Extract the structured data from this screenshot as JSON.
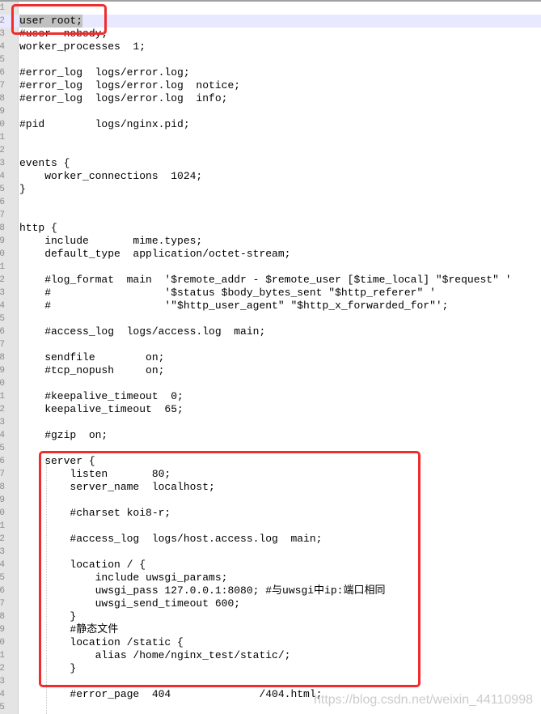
{
  "editor": {
    "lines": [
      "",
      "user root;",
      "#user  nobody;",
      "worker_processes  1;",
      "",
      "#error_log  logs/error.log;",
      "#error_log  logs/error.log  notice;",
      "#error_log  logs/error.log  info;",
      "",
      "#pid        logs/nginx.pid;",
      "",
      "",
      "events {",
      "    worker_connections  1024;",
      "}",
      "",
      "",
      "http {",
      "    include       mime.types;",
      "    default_type  application/octet-stream;",
      "",
      "    #log_format  main  '$remote_addr - $remote_user [$time_local] \"$request\" '",
      "    #                  '$status $body_bytes_sent \"$http_referer\" '",
      "    #                  '\"$http_user_agent\" \"$http_x_forwarded_for\"';",
      "",
      "    #access_log  logs/access.log  main;",
      "",
      "    sendfile        on;",
      "    #tcp_nopush     on;",
      "",
      "    #keepalive_timeout  0;",
      "    keepalive_timeout  65;",
      "",
      "    #gzip  on;",
      "",
      "    server {",
      "        listen       80;",
      "        server_name  localhost;",
      "",
      "        #charset koi8-r;",
      "",
      "        #access_log  logs/host.access.log  main;",
      "",
      "        location / {",
      "            include uwsgi_params;",
      "            uwsgi_pass 127.0.0.1:8080; #与uwsgi中ip:端口相同",
      "            uwsgi_send_timeout 600;",
      "        }",
      "        #静态文件",
      "        location /static {",
      "            alias /home/nginx_test/static/;",
      "        }",
      "",
      "        #error_page  404              /404.html;",
      ""
    ],
    "current_line": 2,
    "highlight_color": "#f02c2c"
  },
  "watermark": "https://blog.csdn.net/weixin_44110998"
}
